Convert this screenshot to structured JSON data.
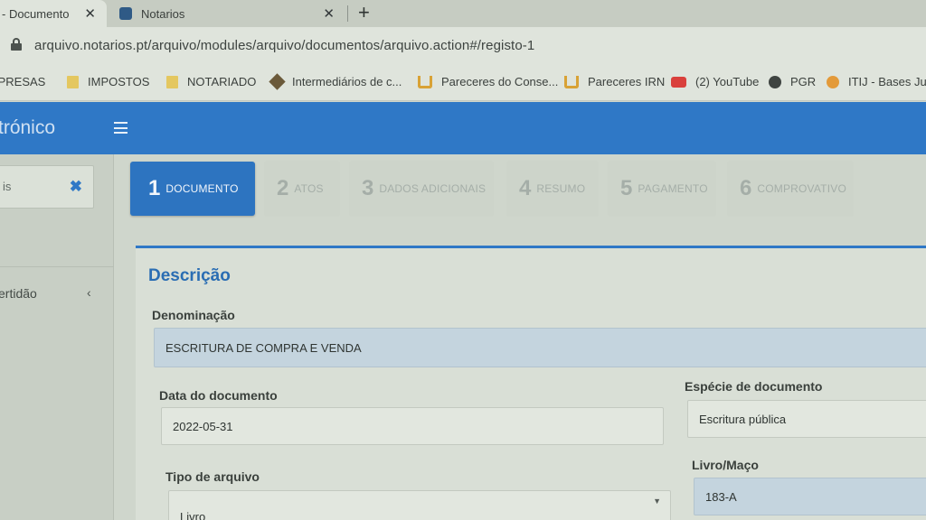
{
  "browser": {
    "tabs": [
      {
        "title": "- Documento",
        "close": "✕"
      },
      {
        "title": "Notarios",
        "close": "✕"
      }
    ],
    "new_tab": "+",
    "url": "arquivo.notarios.pt/arquivo/modules/arquivo/documentos/arquivo.action#/registo-1",
    "bookmarks": [
      {
        "label": "IPRESAS",
        "icon": "none"
      },
      {
        "label": "IMPOSTOS",
        "icon": "folder-icon"
      },
      {
        "label": "NOTARIADO",
        "icon": "folder-icon"
      },
      {
        "label": "Intermediários de c...",
        "icon": "site-icon"
      },
      {
        "label": "Pareceres do Conse...",
        "icon": "site-icon"
      },
      {
        "label": "Pareceres IRN",
        "icon": "site-icon"
      },
      {
        "label": "(2) YouTube",
        "icon": "youtube-icon"
      },
      {
        "label": "PGR",
        "icon": "globe-icon"
      },
      {
        "label": "ITIJ - Bases Juríd",
        "icon": "site-icon"
      }
    ]
  },
  "app": {
    "brand": "trónico",
    "sidebar": {
      "search_text": "is",
      "clear": "✖",
      "item": "ertidão",
      "chevron": "‹"
    },
    "steps": [
      {
        "num": "1",
        "label": "DOCUMENTO"
      },
      {
        "num": "2",
        "label": "ATOS"
      },
      {
        "num": "3",
        "label": "DADOS ADICIONAIS"
      },
      {
        "num": "4",
        "label": "RESUMO"
      },
      {
        "num": "5",
        "label": "PAGAMENTO"
      },
      {
        "num": "6",
        "label": "COMPROVATIVO"
      }
    ],
    "form": {
      "section_title": "Descrição",
      "denominacao_label": "Denominação",
      "denominacao_value": "ESCRITURA DE COMPRA E VENDA",
      "data_label": "Data do documento",
      "data_value": "2022-05-31",
      "especie_label": "Espécie de documento",
      "especie_value": "Escritura pública",
      "tipo_label": "Tipo de arquivo",
      "tipo_value": "Livro",
      "livro_label": "Livro/Maço",
      "livro_value": "183-A"
    }
  },
  "colors": {
    "header": "#2f78c6",
    "active_step": "#2d74c0",
    "section_title": "#2a6db3"
  }
}
